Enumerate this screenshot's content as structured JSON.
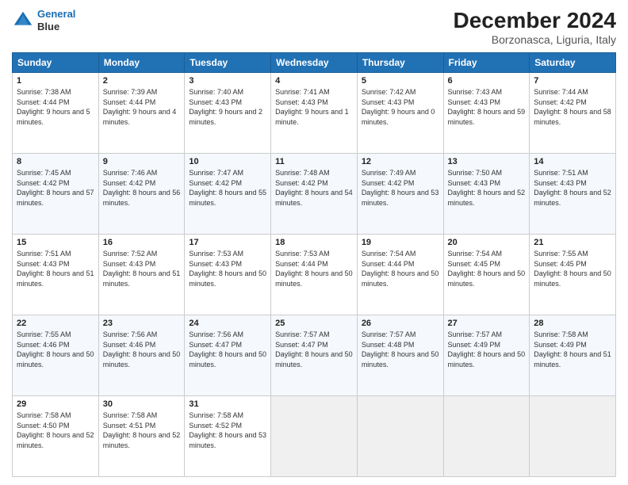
{
  "header": {
    "logo_line1": "General",
    "logo_line2": "Blue",
    "main_title": "December 2024",
    "subtitle": "Borzonasca, Liguria, Italy"
  },
  "calendar": {
    "headers": [
      "Sunday",
      "Monday",
      "Tuesday",
      "Wednesday",
      "Thursday",
      "Friday",
      "Saturday"
    ],
    "weeks": [
      [
        {
          "day": "1",
          "sunrise": "7:38 AM",
          "sunset": "4:44 PM",
          "daylight": "9 hours and 5 minutes."
        },
        {
          "day": "2",
          "sunrise": "7:39 AM",
          "sunset": "4:44 PM",
          "daylight": "9 hours and 4 minutes."
        },
        {
          "day": "3",
          "sunrise": "7:40 AM",
          "sunset": "4:43 PM",
          "daylight": "9 hours and 2 minutes."
        },
        {
          "day": "4",
          "sunrise": "7:41 AM",
          "sunset": "4:43 PM",
          "daylight": "9 hours and 1 minute."
        },
        {
          "day": "5",
          "sunrise": "7:42 AM",
          "sunset": "4:43 PM",
          "daylight": "9 hours and 0 minutes."
        },
        {
          "day": "6",
          "sunrise": "7:43 AM",
          "sunset": "4:43 PM",
          "daylight": "8 hours and 59 minutes."
        },
        {
          "day": "7",
          "sunrise": "7:44 AM",
          "sunset": "4:42 PM",
          "daylight": "8 hours and 58 minutes."
        }
      ],
      [
        {
          "day": "8",
          "sunrise": "7:45 AM",
          "sunset": "4:42 PM",
          "daylight": "8 hours and 57 minutes."
        },
        {
          "day": "9",
          "sunrise": "7:46 AM",
          "sunset": "4:42 PM",
          "daylight": "8 hours and 56 minutes."
        },
        {
          "day": "10",
          "sunrise": "7:47 AM",
          "sunset": "4:42 PM",
          "daylight": "8 hours and 55 minutes."
        },
        {
          "day": "11",
          "sunrise": "7:48 AM",
          "sunset": "4:42 PM",
          "daylight": "8 hours and 54 minutes."
        },
        {
          "day": "12",
          "sunrise": "7:49 AM",
          "sunset": "4:42 PM",
          "daylight": "8 hours and 53 minutes."
        },
        {
          "day": "13",
          "sunrise": "7:50 AM",
          "sunset": "4:43 PM",
          "daylight": "8 hours and 52 minutes."
        },
        {
          "day": "14",
          "sunrise": "7:51 AM",
          "sunset": "4:43 PM",
          "daylight": "8 hours and 52 minutes."
        }
      ],
      [
        {
          "day": "15",
          "sunrise": "7:51 AM",
          "sunset": "4:43 PM",
          "daylight": "8 hours and 51 minutes."
        },
        {
          "day": "16",
          "sunrise": "7:52 AM",
          "sunset": "4:43 PM",
          "daylight": "8 hours and 51 minutes."
        },
        {
          "day": "17",
          "sunrise": "7:53 AM",
          "sunset": "4:43 PM",
          "daylight": "8 hours and 50 minutes."
        },
        {
          "day": "18",
          "sunrise": "7:53 AM",
          "sunset": "4:44 PM",
          "daylight": "8 hours and 50 minutes."
        },
        {
          "day": "19",
          "sunrise": "7:54 AM",
          "sunset": "4:44 PM",
          "daylight": "8 hours and 50 minutes."
        },
        {
          "day": "20",
          "sunrise": "7:54 AM",
          "sunset": "4:45 PM",
          "daylight": "8 hours and 50 minutes."
        },
        {
          "day": "21",
          "sunrise": "7:55 AM",
          "sunset": "4:45 PM",
          "daylight": "8 hours and 50 minutes."
        }
      ],
      [
        {
          "day": "22",
          "sunrise": "7:55 AM",
          "sunset": "4:46 PM",
          "daylight": "8 hours and 50 minutes."
        },
        {
          "day": "23",
          "sunrise": "7:56 AM",
          "sunset": "4:46 PM",
          "daylight": "8 hours and 50 minutes."
        },
        {
          "day": "24",
          "sunrise": "7:56 AM",
          "sunset": "4:47 PM",
          "daylight": "8 hours and 50 minutes."
        },
        {
          "day": "25",
          "sunrise": "7:57 AM",
          "sunset": "4:47 PM",
          "daylight": "8 hours and 50 minutes."
        },
        {
          "day": "26",
          "sunrise": "7:57 AM",
          "sunset": "4:48 PM",
          "daylight": "8 hours and 50 minutes."
        },
        {
          "day": "27",
          "sunrise": "7:57 AM",
          "sunset": "4:49 PM",
          "daylight": "8 hours and 50 minutes."
        },
        {
          "day": "28",
          "sunrise": "7:58 AM",
          "sunset": "4:49 PM",
          "daylight": "8 hours and 51 minutes."
        }
      ],
      [
        {
          "day": "29",
          "sunrise": "7:58 AM",
          "sunset": "4:50 PM",
          "daylight": "8 hours and 52 minutes."
        },
        {
          "day": "30",
          "sunrise": "7:58 AM",
          "sunset": "4:51 PM",
          "daylight": "8 hours and 52 minutes."
        },
        {
          "day": "31",
          "sunrise": "7:58 AM",
          "sunset": "4:52 PM",
          "daylight": "8 hours and 53 minutes."
        },
        null,
        null,
        null,
        null
      ]
    ]
  }
}
